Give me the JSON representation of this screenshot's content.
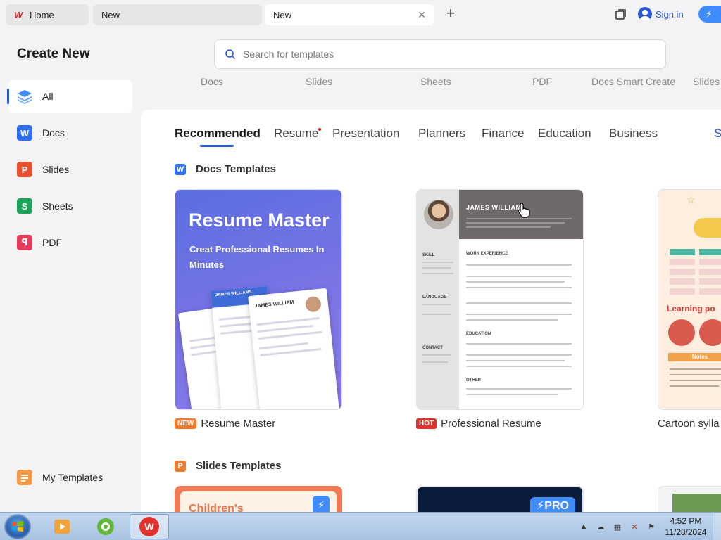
{
  "tabs": [
    {
      "label": "Home"
    },
    {
      "label": "New"
    },
    {
      "label": "New"
    }
  ],
  "header": {
    "sign_in": "Sign in"
  },
  "sidebar": {
    "title": "Create New",
    "items": [
      {
        "label": "All",
        "icon": "layers-icon"
      },
      {
        "label": "Docs",
        "icon": "docs-icon"
      },
      {
        "label": "Slides",
        "icon": "slides-icon"
      },
      {
        "label": "Sheets",
        "icon": "sheets-icon"
      },
      {
        "label": "PDF",
        "icon": "pdf-icon"
      }
    ],
    "my_templates": "My Templates"
  },
  "search": {
    "placeholder": "Search for templates"
  },
  "type_bar": [
    "Docs",
    "Slides",
    "Sheets",
    "PDF",
    "Docs Smart Create",
    "Slides"
  ],
  "categories": [
    "Recommended",
    "Resume",
    "Presentation",
    "Planners",
    "Finance",
    "Education",
    "Business",
    "S"
  ],
  "docs_section": {
    "title": "Docs Templates",
    "cards": [
      {
        "badge": "NEW",
        "badge_color": "#f07a2e",
        "caption": "Resume Master",
        "heading": "Resume Master",
        "subheading": "Creat Professional Resumes In Minutes",
        "mock_name_1": "JAMES WILLIAMS",
        "mock_name_2": "JAMES WILLIAM"
      },
      {
        "badge": "HOT",
        "badge_color": "#e0312d",
        "caption": "Professional Resume",
        "resume_name": "JAMES WILLIAM",
        "sections_left": [
          "SKILL",
          "LANGUAGE",
          "CONTACT"
        ],
        "sections_right": [
          "WORK EXPERIENCE",
          "EDUCATION",
          "OTHER"
        ]
      },
      {
        "caption": "Cartoon sylla",
        "learning": "Learning po",
        "notes": "Notes"
      }
    ]
  },
  "slides_section": {
    "title": "Slides Templates",
    "card1_text": "Children's",
    "pro_badge": "⚡PRO"
  },
  "taskbar": {
    "time": "4:52 PM",
    "date": "11/28/2024"
  },
  "colors": {
    "accent": "#2d5bd8",
    "wps_red": "#e0231d",
    "docs": "#2d6ff0",
    "slides": "#e8502e",
    "sheets": "#1ea35d",
    "pdf": "#e63b5a"
  }
}
